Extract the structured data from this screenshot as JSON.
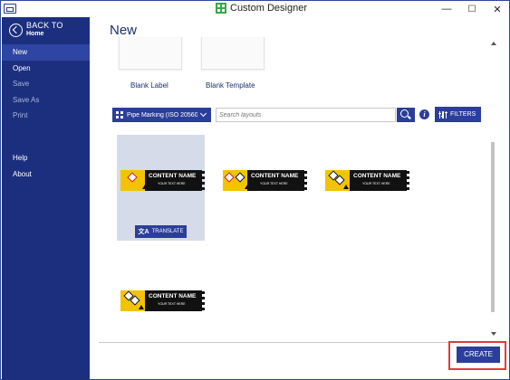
{
  "window": {
    "title": "Custom Designer",
    "controls": {
      "minimize": "—",
      "maximize": "☐",
      "close": "✕"
    }
  },
  "sidebar": {
    "back": {
      "title": "BACK TO",
      "subtitle": "Home"
    },
    "items": [
      {
        "label": "New",
        "state": "active"
      },
      {
        "label": "Open",
        "state": "enabled"
      },
      {
        "label": "Save",
        "state": "disabled"
      },
      {
        "label": "Save As",
        "state": "disabled"
      },
      {
        "label": "Print",
        "state": "disabled"
      },
      {
        "label": "Help",
        "state": "enabled"
      },
      {
        "label": "About",
        "state": "enabled"
      }
    ]
  },
  "main": {
    "heading": "New",
    "blanks": [
      {
        "label": "Blank Label"
      },
      {
        "label": "Blank Template"
      }
    ],
    "toolbar": {
      "category": "Pipe Marking (ISO 20560)",
      "search_placeholder": "Search layouts",
      "info_icon": "i",
      "filters_label": "FILTERS"
    },
    "layouts": [
      {
        "name": "CONTENT NAME",
        "sub": "YOUR TEXT HERE",
        "icon": "flammable-diamond",
        "selected": true
      },
      {
        "name": "CONTENT NAME",
        "sub": "YOUR TEXT HERE",
        "icon": "double-diamond",
        "selected": false
      },
      {
        "name": "CONTENT NAME",
        "sub": "YOUR TEXT HERE",
        "icon": "toxic-diamond",
        "selected": false
      },
      {
        "name": "CONTENT NAME",
        "sub": "YOUR TEXT HERE",
        "icon": "toxic-diamond",
        "selected": false
      }
    ],
    "translate_label": "TRANSLATE",
    "create_label": "CREATE"
  },
  "colors": {
    "sidebar": "#1c2f7f",
    "accent": "#2b3e99",
    "label_yellow": "#f3c300",
    "highlight": "#e23a3a"
  }
}
